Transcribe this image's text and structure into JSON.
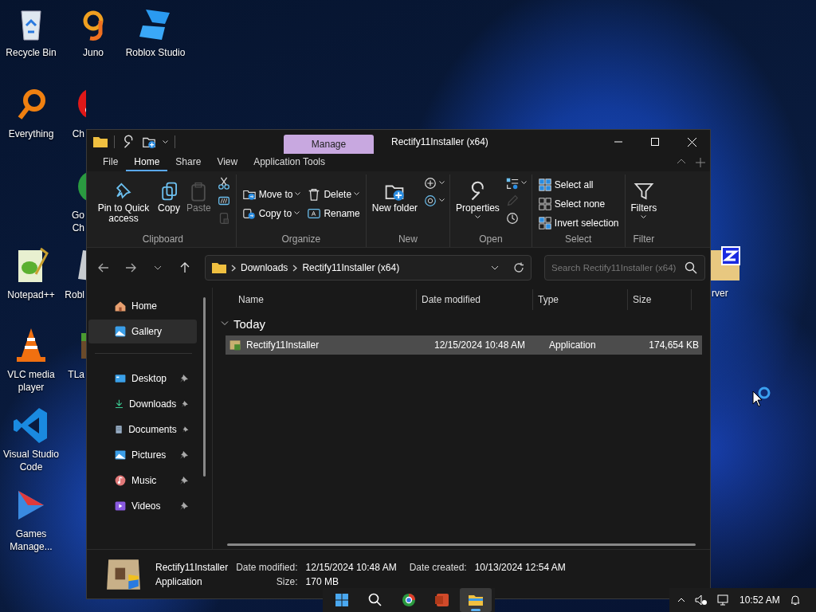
{
  "desktop_icons": [
    {
      "label": "Recycle Bin",
      "kind": "recycle-bin"
    },
    {
      "label": "Juno",
      "kind": "juno"
    },
    {
      "label": "Roblox Studio",
      "kind": "roblox"
    },
    {
      "label": "Everything",
      "kind": "magnifier"
    },
    {
      "label": "Ch",
      "kind": "red-ball"
    },
    {
      "label": "Go Ch",
      "kind": "chrome"
    },
    {
      "label": "Notepad++",
      "kind": "notepad"
    },
    {
      "label": "Robl",
      "kind": "roblox-grey"
    },
    {
      "label": "VLC media player",
      "kind": "cone"
    },
    {
      "label": "TLa",
      "kind": "block"
    },
    {
      "label": "Visual Studio Code",
      "kind": "vscode"
    },
    {
      "label": "Games Manage...",
      "kind": "play"
    },
    {
      "label": "rver",
      "kind": "zip"
    }
  ],
  "window": {
    "title": "Rectify11Installer (x64)",
    "context_tab": "Manage",
    "menu_tabs": [
      {
        "label": "File",
        "selected": false
      },
      {
        "label": "Home",
        "selected": true
      },
      {
        "label": "Share",
        "selected": false
      },
      {
        "label": "View",
        "selected": false
      },
      {
        "label": "Application Tools",
        "selected": false
      }
    ],
    "ribbon": [
      {
        "label": "Clipboard",
        "columns": [
          [
            {
              "kind": "large",
              "label": "Pin to Quick access",
              "disabled": false,
              "dropdown": false
            }
          ],
          [
            {
              "kind": "large",
              "label": "Copy",
              "disabled": false,
              "dropdown": false
            }
          ],
          [
            {
              "kind": "large",
              "label": "Paste",
              "disabled": true,
              "dropdown": false
            }
          ],
          [
            {
              "kind": "mini",
              "disabled": false,
              "dropdown": false
            },
            {
              "kind": "mini",
              "disabled": false,
              "dropdown": false
            },
            {
              "kind": "mini",
              "disabled": true,
              "dropdown": false
            }
          ]
        ]
      },
      {
        "label": "Organize",
        "columns": [
          [
            {
              "kind": "small",
              "label": "Move to",
              "disabled": false,
              "dropdown": true
            },
            {
              "kind": "small",
              "label": "Copy to",
              "disabled": false,
              "dropdown": true
            }
          ],
          [
            {
              "kind": "small",
              "label": "Delete",
              "disabled": false,
              "dropdown": true
            },
            {
              "kind": "small",
              "label": "Rename",
              "disabled": false,
              "dropdown": false
            }
          ]
        ]
      },
      {
        "label": "New",
        "columns": [
          [
            {
              "kind": "large",
              "label": "New folder",
              "disabled": false,
              "dropdown": false
            }
          ],
          [
            {
              "kind": "mini",
              "disabled": false,
              "dropdown": true
            },
            {
              "kind": "mini",
              "disabled": false,
              "dropdown": true
            }
          ]
        ]
      },
      {
        "label": "Open",
        "columns": [
          [
            {
              "kind": "large",
              "label": "Properties",
              "disabled": false,
              "dropdown": true
            }
          ],
          [
            {
              "kind": "mini",
              "disabled": false,
              "dropdown": true
            },
            {
              "kind": "mini",
              "disabled": true,
              "dropdown": false
            },
            {
              "kind": "mini",
              "disabled": false,
              "dropdown": false
            }
          ]
        ]
      },
      {
        "label": "Select",
        "columns": [
          [
            {
              "kind": "small",
              "label": "Select all",
              "disabled": false,
              "dropdown": false
            },
            {
              "kind": "small",
              "label": "Select none",
              "disabled": false,
              "dropdown": false
            },
            {
              "kind": "small",
              "label": "Invert selection",
              "disabled": false,
              "dropdown": false
            }
          ]
        ]
      },
      {
        "label": "Filter",
        "columns": [
          [
            {
              "kind": "large",
              "label": "Filters",
              "disabled": false,
              "dropdown": true
            }
          ]
        ]
      }
    ],
    "breadcrumbs": [
      "Downloads",
      "Rectify11Installer (x64)"
    ],
    "search": {
      "placeholder": "Search Rectify11Installer (x64)"
    },
    "sidebar": [
      {
        "label": "Home",
        "selected": false,
        "pinned": false
      },
      {
        "label": "Gallery",
        "selected": true,
        "pinned": false
      },
      {
        "label": "Desktop",
        "selected": false,
        "pinned": true
      },
      {
        "label": "Downloads",
        "selected": false,
        "pinned": true
      },
      {
        "label": "Documents",
        "selected": false,
        "pinned": true
      },
      {
        "label": "Pictures",
        "selected": false,
        "pinned": true
      },
      {
        "label": "Music",
        "selected": false,
        "pinned": true
      },
      {
        "label": "Videos",
        "selected": false,
        "pinned": true
      }
    ],
    "columns": [
      "Name",
      "Date modified",
      "Type",
      "Size"
    ],
    "groups": [
      {
        "label": "Today",
        "expanded": true,
        "rows": [
          {
            "name": "Rectify11Installer",
            "date_modified": "12/15/2024 10:48 AM",
            "type": "Application",
            "size": "174,654 KB",
            "selected": true
          }
        ]
      }
    ],
    "details": {
      "name": "Rectify11Installer",
      "type": "Application",
      "fields": [
        {
          "label": "Date modified:",
          "value": "12/15/2024 10:48 AM"
        },
        {
          "label": "Date created:",
          "value": "10/13/2024 12:54 AM"
        },
        {
          "label": "Size:",
          "value": "170 MB"
        }
      ]
    }
  },
  "taskbar": {
    "apps": [
      {
        "kind": "start",
        "active": false
      },
      {
        "kind": "search",
        "active": false
      },
      {
        "kind": "chrome",
        "active": false
      },
      {
        "kind": "powerpoint",
        "active": false
      },
      {
        "kind": "explorer",
        "active": true
      }
    ],
    "time": "10:52 AM"
  }
}
